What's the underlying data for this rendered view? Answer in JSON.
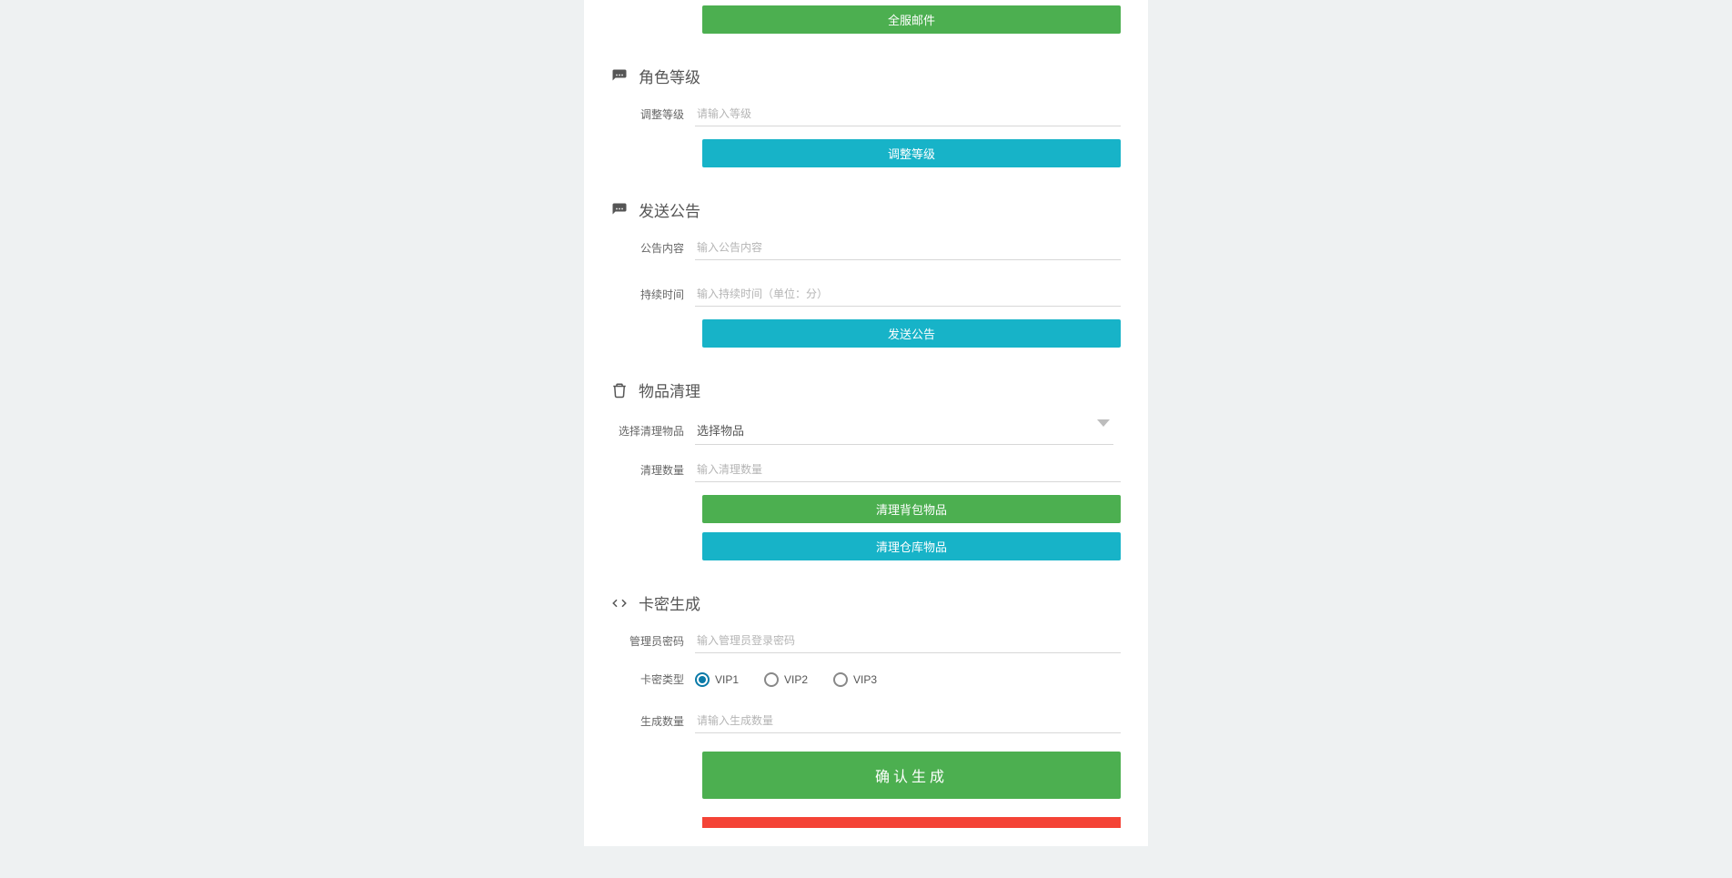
{
  "top_button": "全服邮件",
  "role_level": {
    "title": "角色等级",
    "adjust_label": "调整等级",
    "adjust_placeholder": "请输入等级",
    "button": "调整等级"
  },
  "announcement": {
    "title": "发送公告",
    "content_label": "公告内容",
    "content_placeholder": "输入公告内容",
    "duration_label": "持续时间",
    "duration_placeholder": "输入持续时间（单位：分）",
    "button": "发送公告"
  },
  "item_clean": {
    "title": "物品清理",
    "select_label": "选择清理物品",
    "select_value": "选择物品",
    "qty_label": "清理数量",
    "qty_placeholder": "输入清理数量",
    "button_bag": "清理背包物品",
    "button_warehouse": "清理仓库物品"
  },
  "card_gen": {
    "title": "卡密生成",
    "admin_label": "管理员密码",
    "admin_placeholder": "输入管理员登录密码",
    "type_label": "卡密类型",
    "type_options": [
      "VIP1",
      "VIP2",
      "VIP3"
    ],
    "type_selected": "VIP1",
    "qty_label": "生成数量",
    "qty_placeholder": "请输入生成数量",
    "button_confirm": "确认生成"
  }
}
